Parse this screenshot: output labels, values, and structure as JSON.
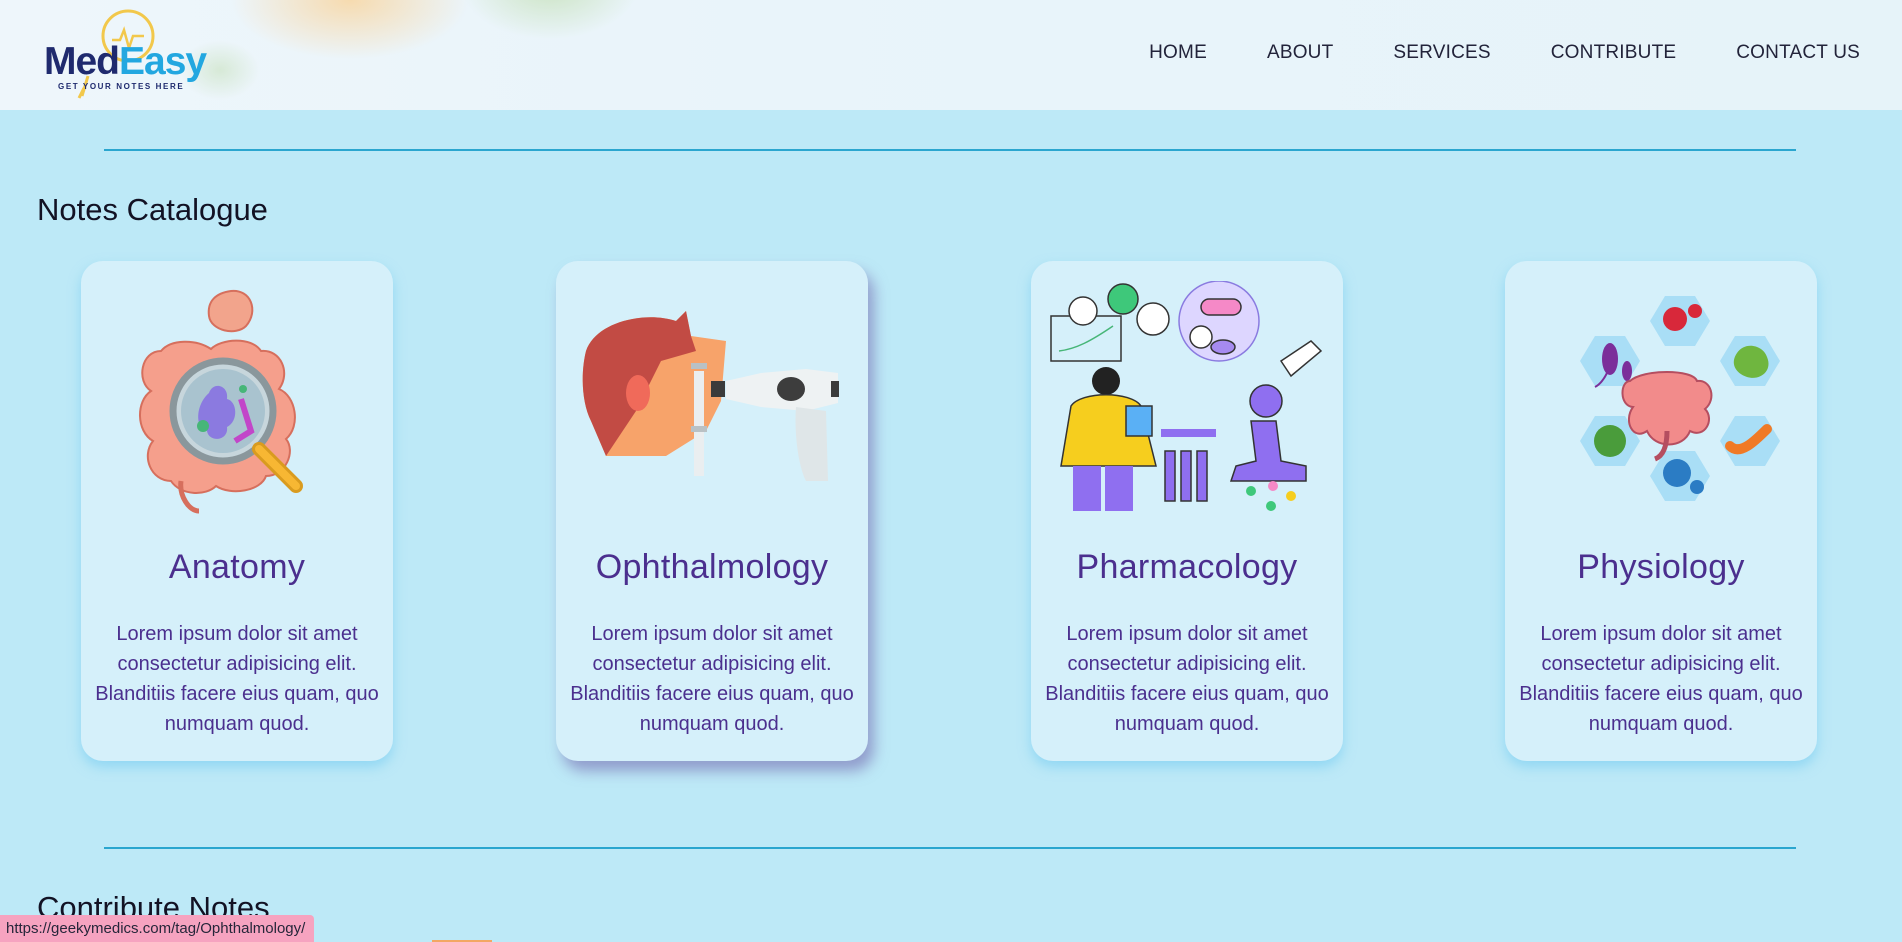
{
  "header": {
    "logo_med": "Med",
    "logo_easy": "Easy",
    "logo_tagline": "GET YOUR NOTES HERE",
    "nav": [
      "HOME",
      "ABOUT",
      "SERVICES",
      "CONTRIBUTE",
      "CONTACT US"
    ]
  },
  "catalogue": {
    "title": "Notes Catalogue",
    "cards": [
      {
        "title": "Anatomy",
        "text": "Lorem ipsum dolor sit amet consectetur adipisicing elit. Blanditiis facere eius quam, quo numquam quod.",
        "icon": "intestine-magnifier-icon"
      },
      {
        "title": "Ophthalmology",
        "text": "Lorem ipsum dolor sit amet consectetur adipisicing elit. Blanditiis facere eius quam, quo numquam quod.",
        "icon": "eye-exam-icon"
      },
      {
        "title": "Pharmacology",
        "text": "Lorem ipsum dolor sit amet consectetur adipisicing elit. Blanditiis facere eius quam, quo numquam quod.",
        "icon": "scientist-microscope-icon"
      },
      {
        "title": "Physiology",
        "text": "Lorem ipsum dolor sit amet consectetur adipisicing elit. Blanditiis facere eius quam, quo numquam quod.",
        "icon": "microbes-hexagon-icon"
      }
    ]
  },
  "contribute": {
    "title": "Contribute Notes"
  },
  "status_bar": {
    "url": "https://geekymedics.com/tag/Ophthalmology/"
  },
  "colors": {
    "background": "#bde9f7",
    "card": "#d5f0fa",
    "accent": "#4b2f8e",
    "divider": "#2aa6cf",
    "status": "#f6a3c0"
  }
}
